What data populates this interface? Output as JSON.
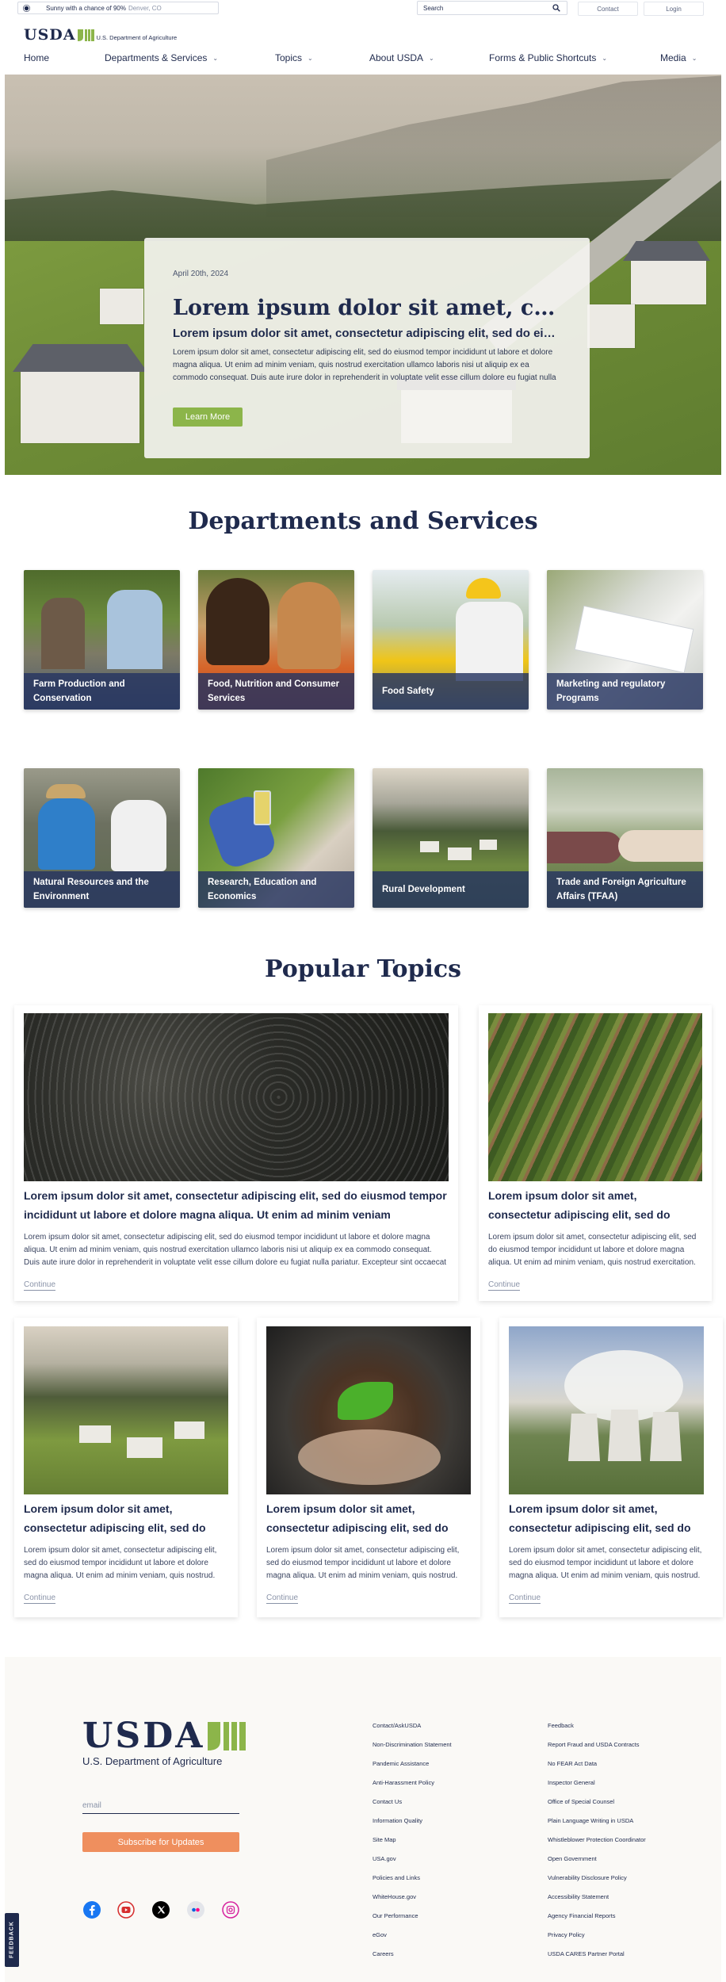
{
  "utility": {
    "weather_text": "Sunny with a chance of 90%",
    "weather_location": "Denver, CO",
    "search_placeholder": "Search",
    "contact": "Contact",
    "login": "Login"
  },
  "logo": {
    "wordmark": "USDA",
    "department": "U.S. Department of Agriculture"
  },
  "nav": [
    {
      "label": "Home",
      "has_menu": false
    },
    {
      "label": "Departments & Services",
      "has_menu": true
    },
    {
      "label": "Topics",
      "has_menu": true
    },
    {
      "label": "About USDA",
      "has_menu": true
    },
    {
      "label": "Forms & Public Shortcuts",
      "has_menu": true
    },
    {
      "label": "Media",
      "has_menu": true
    }
  ],
  "hero": {
    "date": "April 20th, 2024",
    "title": "Lorem ipsum dolor sit amet, consectetur adipiscing",
    "subtitle": "Lorem ipsum dolor sit amet, consectetur adipiscing elit, sed do eiusmod",
    "body": "Lorem ipsum dolor sit amet, consectetur adipiscing elit, sed do eiusmod tempor incididunt ut labore et dolore magna aliqua. Ut enim ad minim veniam, quis nostrud exercitation ullamco laboris nisi ut aliquip ex ea commodo consequat. Duis aute irure dolor in reprehenderit in voluptate velit esse cillum dolore eu fugiat nulla pariatur.",
    "button": "Learn More",
    "slide_count": 3,
    "active_slide": 1
  },
  "departments": {
    "title": "Departments and Services",
    "items": [
      "Farm Production and Conservation",
      "Food, Nutrition and Consumer Services",
      "Food Safety",
      "Marketing and regulatory Programs",
      "Natural Resources and the Environment",
      "Research, Education and Economics",
      "Rural Development",
      "Trade and Foreign Agriculture Affairs (TFAA)"
    ]
  },
  "topics": {
    "title": "Popular Topics",
    "featured": {
      "title": "Lorem ipsum dolor sit amet, consectetur adipiscing elit, sed do eiusmod tempor incididunt ut labore et dolore magna aliqua. Ut enim ad minim veniam",
      "body": "Lorem ipsum dolor sit amet, consectetur adipiscing elit, sed do eiusmod tempor incididunt ut labore et dolore magna aliqua. Ut enim ad minim veniam, quis nostrud exercitation ullamco laboris nisi ut aliquip ex ea commodo consequat. Duis aute irure dolor in reprehenderit in voluptate velit esse cillum dolore eu fugiat nulla pariatur. Excepteur sint occaecat cupidatat non proident.",
      "link": "Continue"
    },
    "items": [
      {
        "title": "Lorem ipsum dolor sit amet, consectetur adipiscing elit, sed do eiusmod",
        "body": "Lorem ipsum dolor sit amet, consectetur adipiscing elit, sed do eiusmod tempor incididunt ut labore et dolore magna aliqua. Ut enim ad minim veniam, quis nostrud exercitation.",
        "link": "Continue"
      },
      {
        "title": "Lorem ipsum dolor sit amet, consectetur adipiscing elit, sed do eiusmod",
        "body": "Lorem ipsum dolor sit amet, consectetur adipiscing elit, sed do eiusmod tempor incididunt ut labore et dolore magna aliqua. Ut enim ad minim veniam, quis nostrud.",
        "link": "Continue"
      },
      {
        "title": "Lorem ipsum dolor sit amet, consectetur adipiscing elit, sed do eiusmod",
        "body": "Lorem ipsum dolor sit amet, consectetur adipiscing elit, sed do eiusmod tempor incididunt ut labore et dolore magna aliqua. Ut enim ad minim veniam, quis nostrud.",
        "link": "Continue"
      },
      {
        "title": "Lorem ipsum dolor sit amet, consectetur adipiscing elit, sed do eiusmod",
        "body": "Lorem ipsum dolor sit amet, consectetur adipiscing elit, sed do eiusmod tempor incididunt ut labore et dolore magna aliqua. Ut enim ad minim veniam, quis nostrud.",
        "link": "Continue"
      }
    ]
  },
  "footer": {
    "email_placeholder": "email",
    "subscribe": "Subscribe for Updates",
    "social": [
      "facebook-icon",
      "youtube-icon",
      "x-icon",
      "flickr-icon",
      "instagram-icon"
    ],
    "col1": [
      "Contact/AskUSDA",
      "Non-Discrimination Statement",
      "Pandemic Assistance",
      "Anti-Harassment Policy",
      "Contact Us",
      "Information Quality",
      "Site Map",
      "USA.gov",
      "Policies and Links",
      "WhiteHouse.gov",
      "Our Performance",
      "eGov",
      "Careers"
    ],
    "col2": [
      "Feedback",
      "Report Fraud and USDA Contracts",
      "No FEAR Act Data",
      "Inspector General",
      "Office of Special Counsel",
      "Plain Language Writing in USDA",
      "Whistleblower Protection Coordinator",
      "Open Government",
      "Vulnerability Disclosure Policy",
      "Accessibility Statement",
      "Agency Financial Reports",
      "Privacy Policy",
      "USDA CARES Partner Portal"
    ],
    "feedback_tab": "FEEDBACK"
  },
  "colors": {
    "navy": "#1f2a4d",
    "green": "#8cb54a",
    "orange": "#ef8f5e"
  }
}
